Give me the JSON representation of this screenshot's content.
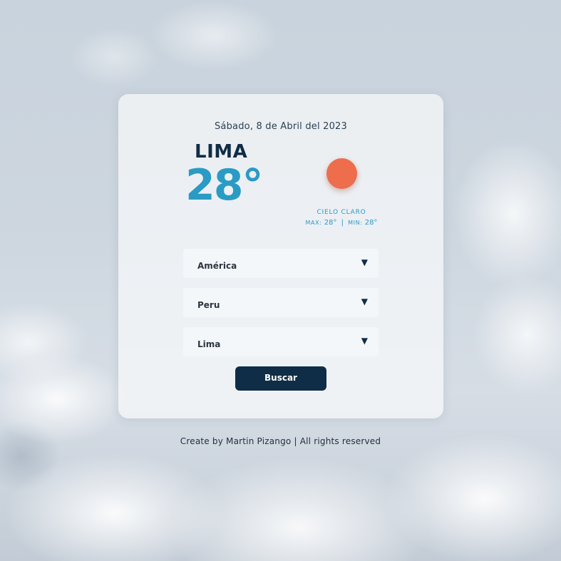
{
  "weather": {
    "date": "Sábado, 8 de Abril del 2023",
    "city": "LIMA",
    "temperature": "28°",
    "condition": "CIELO CLARO",
    "max_label": "MAX:",
    "max_value": "28°",
    "separator": "|",
    "min_label": "MIN:",
    "min_value": "28°",
    "icon": "sun-icon",
    "sun_color": "#ee6d4c"
  },
  "form": {
    "continent": {
      "value": "América",
      "arrow": "▼"
    },
    "country": {
      "value": "Peru",
      "arrow": "▼"
    },
    "city": {
      "value": "Lima",
      "arrow": "▼"
    },
    "search_label": "Buscar"
  },
  "footer": {
    "text": "Create by Martin Pizango | All rights reserved"
  },
  "colors": {
    "accent": "#2a9bc4",
    "dark": "#0f2d46"
  }
}
